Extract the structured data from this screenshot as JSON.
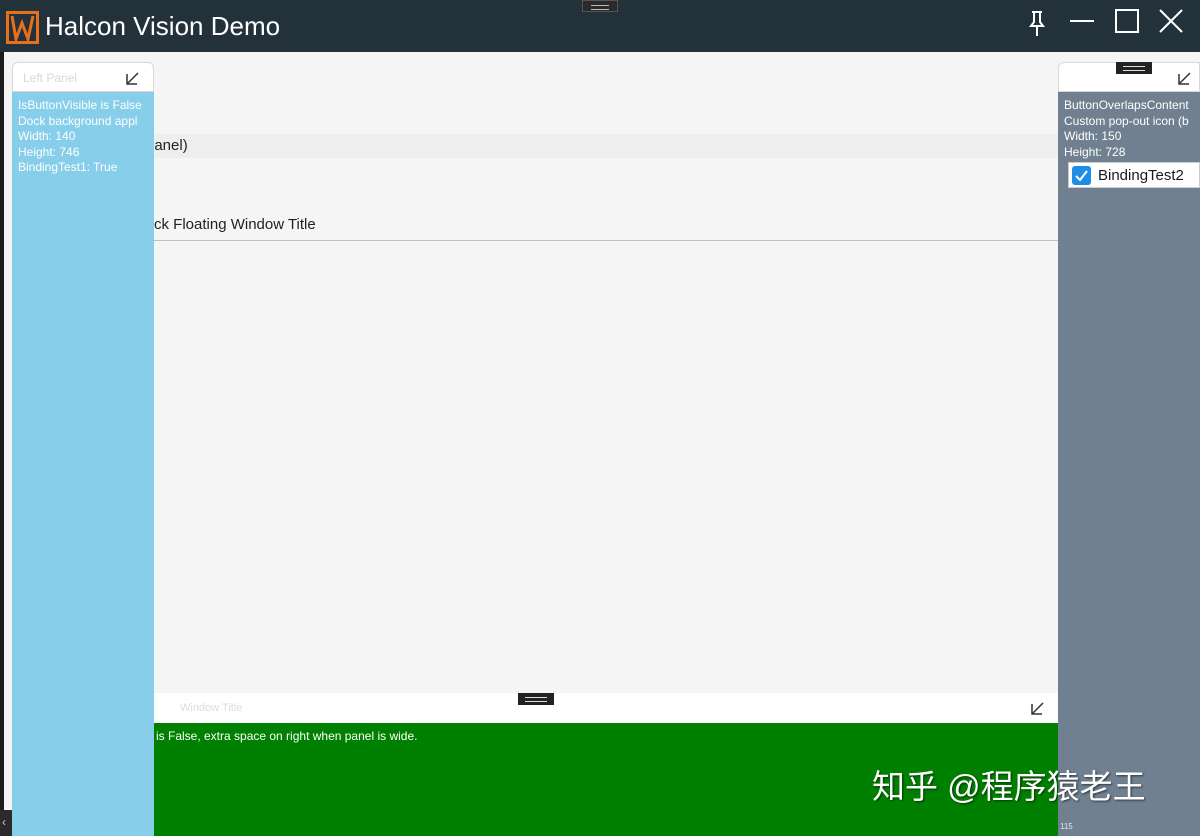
{
  "window": {
    "title": "Halcon Vision Demo",
    "controls": {
      "pin": "pin-icon",
      "minimize": "minimize-icon",
      "maximize": "maximize-icon",
      "close": "close-icon"
    },
    "logo_icon": "halcon-logo-icon"
  },
  "main": {
    "header_text": "panel)",
    "floating_window_title": "ck Floating Window Title"
  },
  "left_panel": {
    "title": "Left Panel",
    "lines": [
      "IsButtonVisible is False",
      "Dock background appl",
      "Width: 140",
      "Height: 746",
      "BindingTest1: True"
    ],
    "background": "#87CEEB"
  },
  "right_panel": {
    "lines": [
      "ButtonOverlapsContent",
      "Custom pop-out icon (b",
      "Width: 150",
      "Height: 728"
    ],
    "checkbox": {
      "label": "BindingTest2",
      "checked": true
    },
    "footer": "115",
    "background": "#708090"
  },
  "bottom_panel": {
    "title": "Window Title",
    "text": "is False, extra space on right when panel is wide.",
    "background": "#008000"
  },
  "watermark": "知乎 @程序猿老王",
  "colors": {
    "titlebar": "#22313A",
    "accent": "#1E8DE6",
    "logo": "#E8701A"
  }
}
